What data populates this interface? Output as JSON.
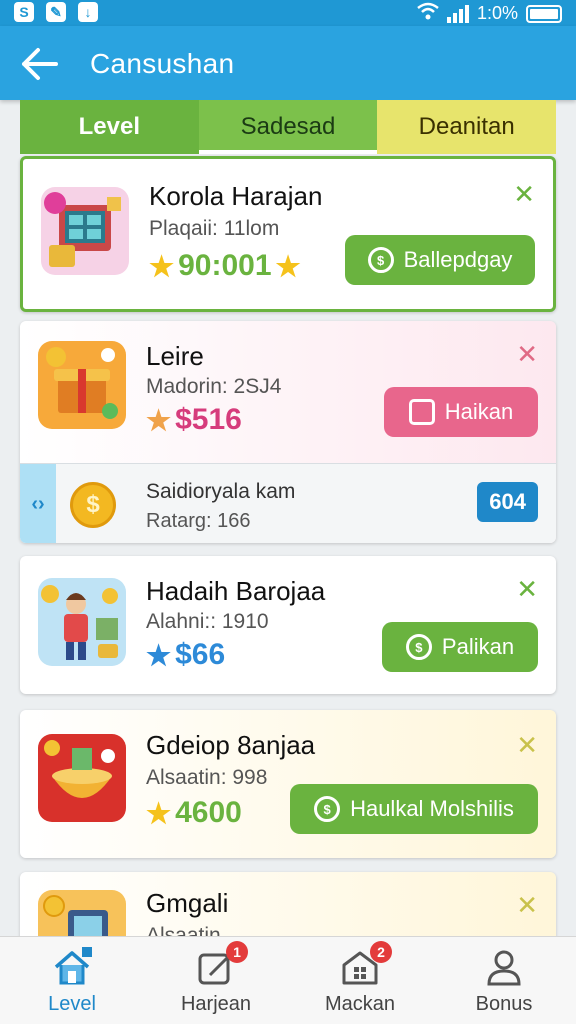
{
  "status_bar": {
    "time": "1:0%"
  },
  "app_bar": {
    "title": "Cansushan"
  },
  "tabs": [
    {
      "label": "Level"
    },
    {
      "label": "Sadesad"
    },
    {
      "label": "Deanitan"
    }
  ],
  "items": [
    {
      "title": "Korola Harajan",
      "subtitle": "Plaqaii: 11lom",
      "price": "90:001",
      "action": "Ballepdgay"
    },
    {
      "title": "Leire",
      "subtitle": "Madorin: 2SJ4",
      "price": "$516",
      "action": "Haikan",
      "sub_row": {
        "title": "Saidioryala kam",
        "subtitle": "Ratarg: 166",
        "badge": "604"
      }
    },
    {
      "title": "Hadaih Barojaa",
      "subtitle": "Alahni:: 1910",
      "price": "$66",
      "action": "Palikan"
    },
    {
      "title": "Gdeiop 8anjaa",
      "subtitle": "Alsaatin: 998",
      "price": "4600",
      "action": "Haulkal Molshilis"
    },
    {
      "title": "Gmgali",
      "subtitle": "Alsaatin"
    }
  ],
  "bottom_nav": [
    {
      "label": "Level",
      "badge": ""
    },
    {
      "label": "Harjean",
      "badge": "1"
    },
    {
      "label": "Mackan",
      "badge": "2"
    },
    {
      "label": "Bonus",
      "badge": ""
    }
  ],
  "colors": {
    "primary": "#2aa3e0",
    "green": "#6ab33f",
    "pink": "#e8668c",
    "price_green": "#6ab33f",
    "price_pink": "#d63c7c",
    "price_blue": "#2d8ad8"
  }
}
